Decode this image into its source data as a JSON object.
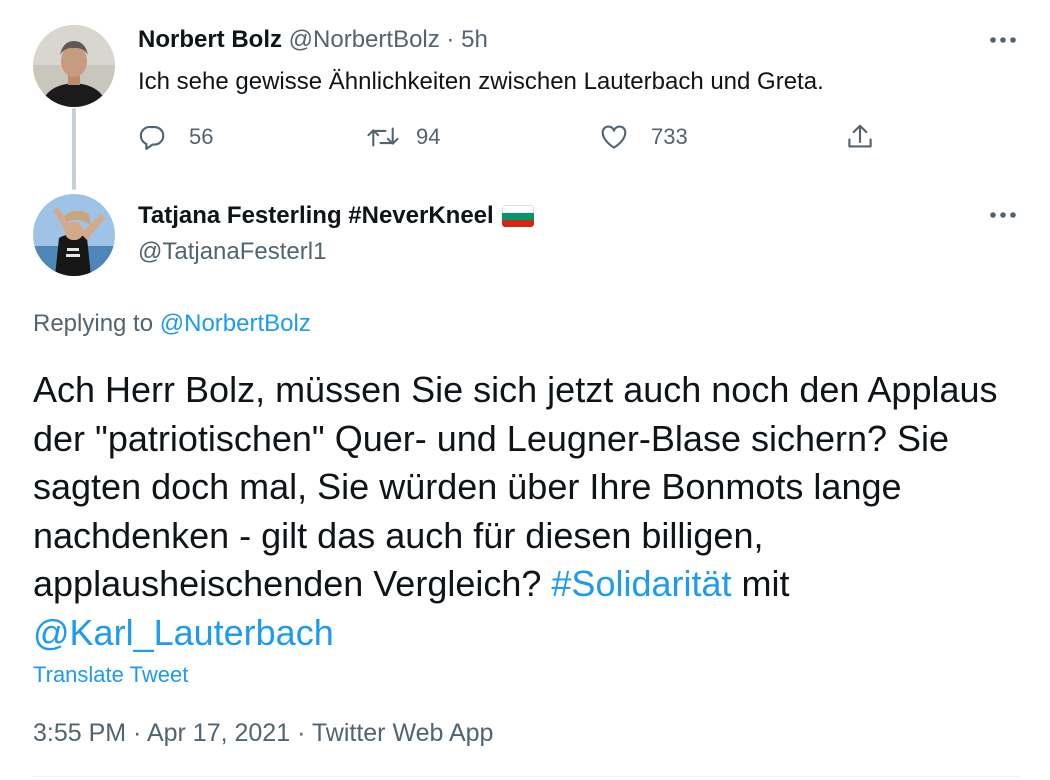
{
  "tweet1": {
    "display_name": "Norbert Bolz",
    "handle": "@NorbertBolz",
    "separator": "·",
    "time": "5h",
    "text": "Ich sehe gewisse Ähnlichkeiten zwischen Lauterbach und Greta.",
    "replies": "56",
    "retweets": "94",
    "likes": "733"
  },
  "tweet2": {
    "display_name": "Tatjana Festerling #NeverKneel",
    "flag_colors": [
      "#ffffff",
      "#00966e",
      "#d62612"
    ],
    "handle": "@TatjanaFesterl1",
    "replying_prefix": "Replying to ",
    "replying_handle": "@NorbertBolz",
    "text_part1": "Ach Herr Bolz, müssen Sie sich jetzt auch noch den Applaus der \"patriotischen\" Quer- und Leugner-Blase sichern? Sie sagten doch mal, Sie würden über Ihre Bonmots lange nachdenken - gilt das auch für diesen billigen, applausheischenden Vergleich? ",
    "hashtag": "#Solidarität",
    "text_part2": " mit ",
    "mention": "@Karl_Lauterbach",
    "translate_label": "Translate Tweet",
    "time": "3:55 PM",
    "meta_sep": " · ",
    "date": "Apr 17, 2021",
    "source": "Twitter Web App"
  },
  "colors": {
    "accent": "#1d9bf0",
    "muted": "#536471",
    "text": "#0f1419"
  },
  "icons": {
    "reply": "reply-icon",
    "retweet": "retweet-icon",
    "like": "heart-icon",
    "share": "share-icon",
    "more": "more-icon"
  }
}
